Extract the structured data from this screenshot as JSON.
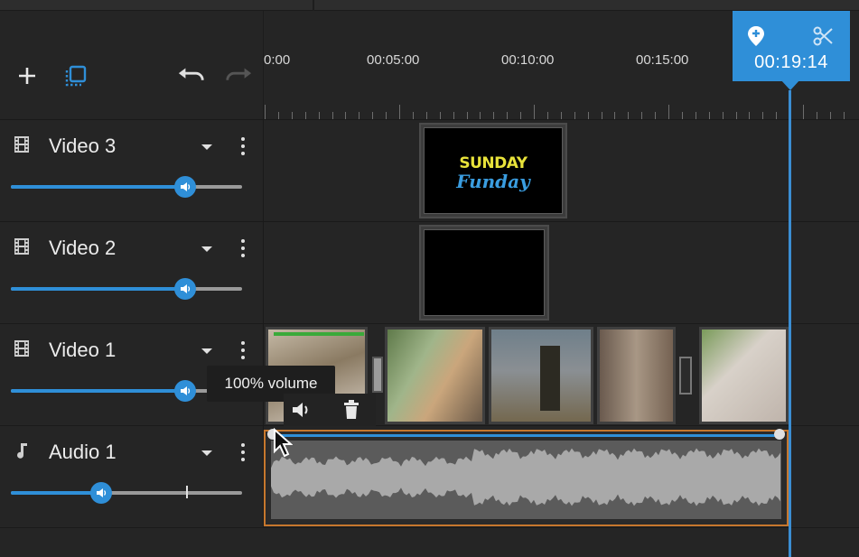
{
  "toolbar": {
    "add_icon": "plus-icon",
    "select_icon": "select-box-icon",
    "undo_icon": "undo-icon",
    "redo_icon": "redo-icon"
  },
  "ruler": {
    "labels": [
      "0:00",
      "00:05:00",
      "00:10:00",
      "00:15:00"
    ]
  },
  "playhead": {
    "time": "00:19:14",
    "marker_icon": "add-marker-icon",
    "split_icon": "scissors-icon"
  },
  "tracks": [
    {
      "name": "Video 3",
      "icon": "film-icon",
      "volume": 0.75
    },
    {
      "name": "Video 2",
      "icon": "film-icon",
      "volume": 0.75
    },
    {
      "name": "Video 1",
      "icon": "film-icon",
      "volume": 0.75
    },
    {
      "name": "Audio 1",
      "icon": "music-note-icon",
      "volume": 0.39
    }
  ],
  "title_card": {
    "line1": "SUNDAY",
    "line2": "Funday"
  },
  "tooltip": {
    "text": "100% volume"
  },
  "colors": {
    "accent": "#2f8fd8",
    "audio_border": "#c6772d",
    "title_yellow": "#e8e23a",
    "title_blue": "#3a9de0"
  }
}
